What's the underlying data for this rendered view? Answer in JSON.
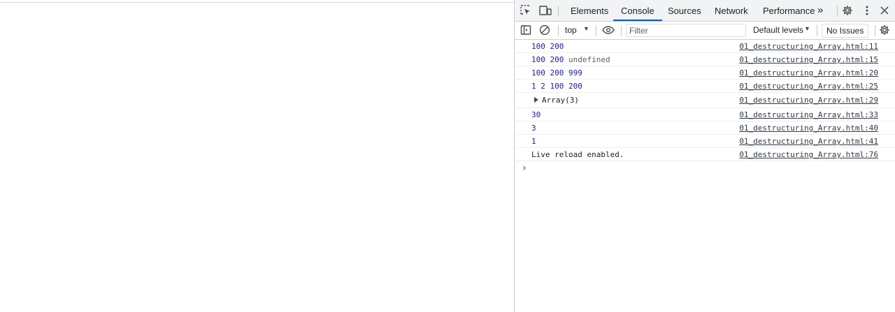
{
  "tabs": [
    {
      "label": "Elements",
      "active": false
    },
    {
      "label": "Console",
      "active": true
    },
    {
      "label": "Sources",
      "active": false
    },
    {
      "label": "Network",
      "active": false
    },
    {
      "label": "Performance",
      "active": false
    }
  ],
  "more_tabs_glyph": "»",
  "toolbar": {
    "context": "top",
    "filter_placeholder": "Filter",
    "levels": "Default levels",
    "issues": "No Issues"
  },
  "console": {
    "messages": [
      {
        "values": [
          "100",
          "200"
        ],
        "source": "01_destructuring_Array.html:11"
      },
      {
        "values": [
          "100",
          "200"
        ],
        "extra": "undefined",
        "source": "01_destructuring_Array.html:15"
      },
      {
        "values": [
          "100",
          "200",
          "999"
        ],
        "source": "01_destructuring_Array.html:20"
      },
      {
        "values": [
          "1",
          "2",
          "100",
          "200"
        ],
        "source": "01_destructuring_Array.html:25"
      },
      {
        "object": "Array(3)",
        "source": "01_destructuring_Array.html:29"
      },
      {
        "values": [
          "30"
        ],
        "source": "01_destructuring_Array.html:33"
      },
      {
        "values": [
          "3"
        ],
        "source": "01_destructuring_Array.html:40"
      },
      {
        "values": [
          "1"
        ],
        "source": "01_destructuring_Array.html:41"
      },
      {
        "text": "Live reload enabled.",
        "source": "01_destructuring_Array.html:76"
      }
    ],
    "prompt_glyph": "›"
  },
  "icons": {
    "inspect": "inspect-element-icon",
    "device": "device-toolbar-icon",
    "settings": "gear-icon",
    "menu": "kebab-menu-icon",
    "close": "close-icon",
    "sidebar": "sidebar-toggle-icon",
    "clear": "clear-console-icon",
    "eye": "eye-icon"
  },
  "colors": {
    "accent": "#0b57d0",
    "number": "#1a1aa6",
    "muted": "#5e5e5e"
  }
}
